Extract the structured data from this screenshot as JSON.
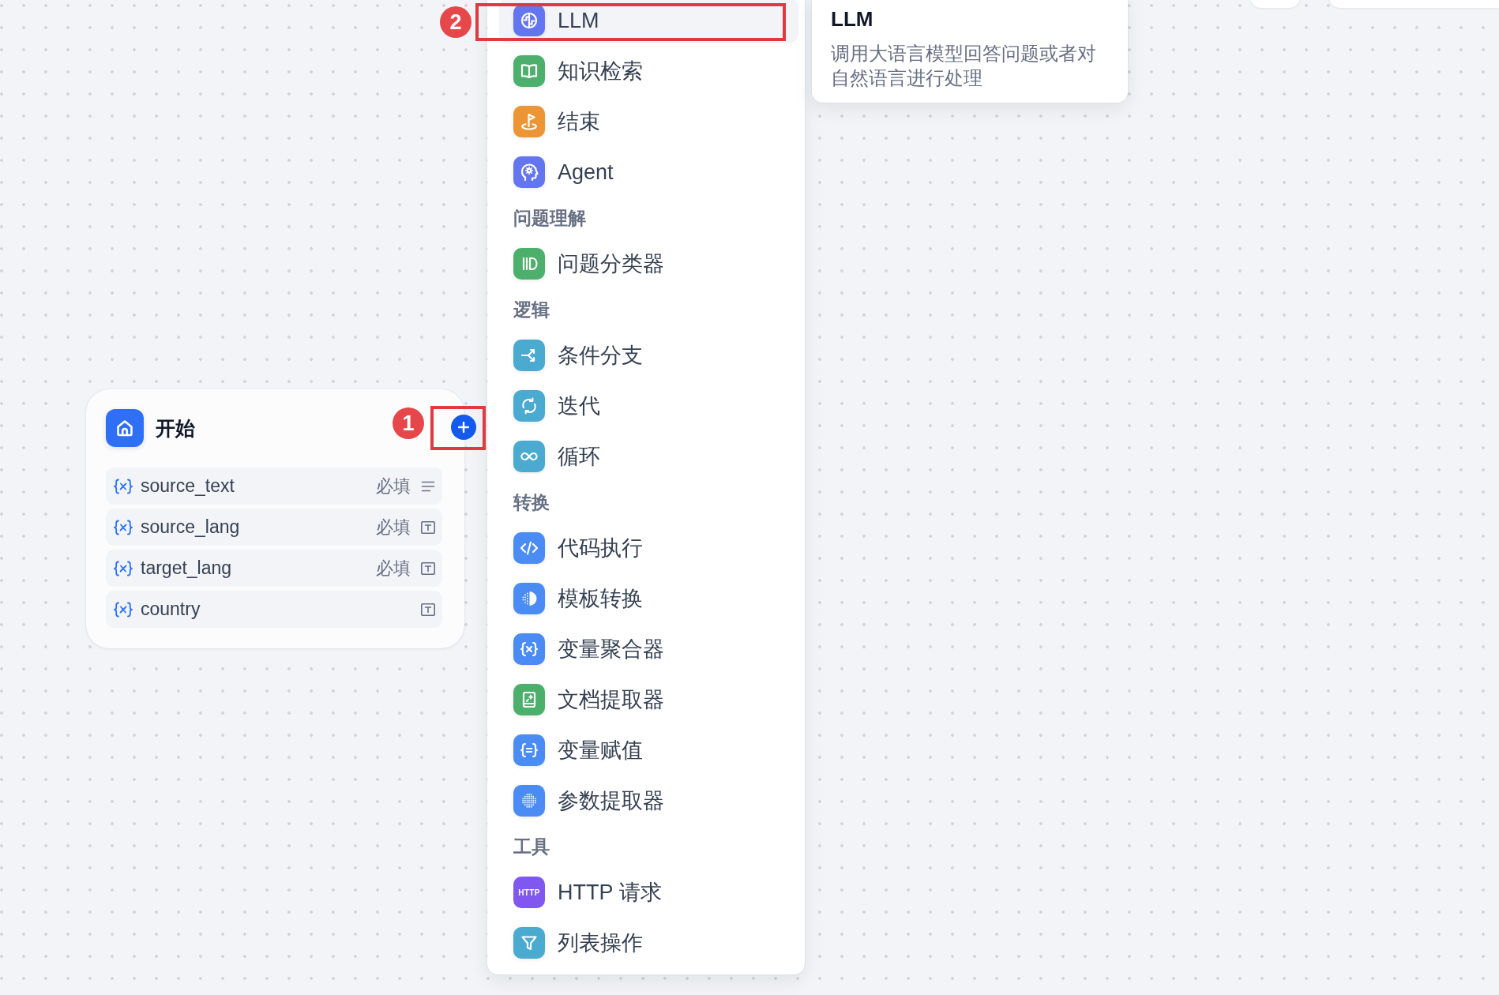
{
  "start_node": {
    "title": "开始",
    "variables": [
      {
        "name": "source_text",
        "badge": "必填",
        "kind": "paragraph"
      },
      {
        "name": "source_lang",
        "badge": "必填",
        "kind": "text-input"
      },
      {
        "name": "target_lang",
        "badge": "必填",
        "kind": "text-input"
      },
      {
        "name": "country",
        "kind": "text-input"
      }
    ]
  },
  "menu": {
    "sections": [
      {
        "items": [
          {
            "label": "LLM",
            "color": "#6475f0",
            "selected": true
          },
          {
            "label": "知识检索",
            "color": "#4caf6c",
            "selected": false
          },
          {
            "label": "结束",
            "color": "#ec9535",
            "selected": false
          },
          {
            "label": "Agent",
            "color": "#6475f0",
            "selected": false
          }
        ]
      },
      {
        "title": "问题理解",
        "items": [
          {
            "label": "问题分类器",
            "color": "#4caf6c",
            "selected": false
          }
        ]
      },
      {
        "title": "逻辑",
        "items": [
          {
            "label": "条件分支",
            "color": "#4aaad0",
            "selected": false
          },
          {
            "label": "迭代",
            "color": "#4aaad0",
            "selected": false
          },
          {
            "label": "循环",
            "color": "#4aaad0",
            "selected": false
          }
        ]
      },
      {
        "title": "转换",
        "items": [
          {
            "label": "代码执行",
            "color": "#4a8cf3",
            "selected": false
          },
          {
            "label": "模板转换",
            "color": "#4a8cf3",
            "selected": false
          },
          {
            "label": "变量聚合器",
            "color": "#4a8cf3",
            "selected": false
          },
          {
            "label": "文档提取器",
            "color": "#4caf6c",
            "selected": false
          },
          {
            "label": "变量赋值",
            "color": "#4a8cf3",
            "selected": false
          },
          {
            "label": "参数提取器",
            "color": "#4a8cf3",
            "selected": false
          }
        ]
      },
      {
        "title": "工具",
        "items": [
          {
            "label": "HTTP 请求",
            "color": "#8058f0",
            "selected": false,
            "icon_text": "HTTP"
          },
          {
            "label": "列表操作",
            "color": "#4aaad0",
            "selected": false
          }
        ]
      }
    ]
  },
  "tooltip": {
    "title": "LLM",
    "description": "调用大语言模型回答问题或者对自然语言进行处理"
  },
  "annotations": [
    {
      "number": "1"
    },
    {
      "number": "2"
    }
  ]
}
